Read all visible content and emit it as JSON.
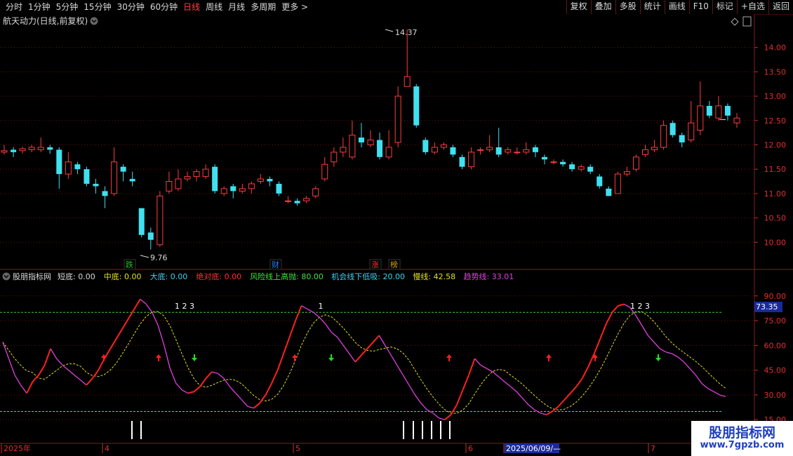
{
  "toolbar": {
    "tabs": [
      "分时",
      "1分钟",
      "5分钟",
      "15分钟",
      "30分钟",
      "60分钟",
      "日线",
      "周线",
      "月线",
      "多周期",
      "更多 >"
    ],
    "active_tab": "日线",
    "right_buttons": [
      "复权",
      "叠加",
      "多股",
      "统计",
      "画线",
      "F10",
      "标记",
      "+自选",
      "返回"
    ]
  },
  "main_chart": {
    "title": "航天动力(日线,前复权)",
    "price_axis": [
      "14.00",
      "13.50",
      "13.00",
      "12.50",
      "12.00",
      "11.50",
      "11.00",
      "10.50",
      "10.00"
    ],
    "high_label": "14.37",
    "low_label": "9.76",
    "badges": [
      {
        "text": "跌",
        "color": "#20c020"
      },
      {
        "text": "财",
        "color": "#2080ff"
      },
      {
        "text": "涨",
        "color": "#ff3030"
      },
      {
        "text": "榜",
        "color": "#d0a000"
      }
    ]
  },
  "indicator": {
    "name": "股朋指标网",
    "params": [
      {
        "label": "短底:",
        "value": "0.00",
        "color": "#d8d8d8"
      },
      {
        "label": "中底:",
        "value": "0.00",
        "color": "#e0e020"
      },
      {
        "label": "大底:",
        "value": "0.00",
        "color": "#40d0f0"
      },
      {
        "label": "绝对底:",
        "value": "0.00",
        "color": "#ff3030"
      },
      {
        "label": "风险线上高抛:",
        "value": "80.00",
        "color": "#40e040"
      },
      {
        "label": "机会线下低吸:",
        "value": "20.00",
        "color": "#40d0f0"
      },
      {
        "label": "慢线:",
        "value": "42.58",
        "color": "#e0e020"
      },
      {
        "label": "趋势线:",
        "value": "33.01",
        "color": "#e040e0"
      }
    ],
    "axis": [
      "90.00",
      "75.00",
      "60.00",
      "45.00",
      "30.00",
      "15.00"
    ],
    "current_value": "73.35",
    "signal_labels": [
      "1 2 3",
      "1",
      "1 2 3"
    ]
  },
  "time_axis": {
    "labels": [
      "2025年",
      "4",
      "5",
      "6",
      "2025/06/09/—",
      "7"
    ]
  },
  "watermark": {
    "line1": "股朋指标网",
    "line2": "www.7gpzb.com"
  },
  "chart_data": {
    "type": "candlestick",
    "y_range": [
      9.5,
      14.6
    ],
    "candles": [
      [
        11.85,
        11.88,
        12.0,
        11.8
      ],
      [
        11.9,
        11.85,
        11.95,
        11.75
      ],
      [
        11.88,
        11.92,
        11.96,
        11.82
      ],
      [
        11.9,
        11.95,
        12.0,
        11.85
      ],
      [
        11.9,
        11.95,
        12.15,
        11.85
      ],
      [
        11.95,
        11.9,
        12.0,
        11.82
      ],
      [
        11.9,
        11.4,
        11.95,
        11.1
      ],
      [
        11.4,
        11.65,
        11.85,
        11.3
      ],
      [
        11.6,
        11.5,
        11.65,
        11.4
      ],
      [
        11.5,
        11.2,
        11.55,
        11.15
      ],
      [
        11.2,
        11.15,
        11.3,
        11.0
      ],
      [
        11.05,
        10.95,
        11.15,
        10.7
      ],
      [
        11.0,
        11.65,
        11.95,
        10.95
      ],
      [
        11.55,
        11.45,
        11.6,
        11.25
      ],
      [
        11.3,
        11.25,
        11.45,
        11.15
      ],
      [
        10.7,
        10.15,
        10.7,
        10.1
      ],
      [
        10.2,
        10.05,
        10.3,
        9.85
      ],
      [
        9.95,
        10.95,
        11.05,
        9.9
      ],
      [
        11.05,
        11.25,
        11.45,
        11.0
      ],
      [
        11.1,
        11.3,
        11.5,
        11.05
      ],
      [
        11.3,
        11.35,
        11.45,
        11.25
      ],
      [
        11.35,
        11.45,
        11.5,
        11.25
      ],
      [
        11.35,
        11.5,
        11.6,
        11.3
      ],
      [
        11.55,
        11.05,
        11.6,
        11.0
      ],
      [
        11.0,
        11.1,
        11.15,
        10.95
      ],
      [
        11.15,
        11.05,
        11.2,
        10.9
      ],
      [
        11.05,
        11.1,
        11.2,
        11.0
      ],
      [
        11.1,
        11.2,
        11.25,
        11.0
      ],
      [
        11.25,
        11.3,
        11.4,
        11.2
      ],
      [
        11.3,
        11.25,
        11.35,
        11.15
      ],
      [
        11.2,
        11.0,
        11.25,
        10.95
      ],
      [
        10.85,
        10.85,
        10.95,
        10.8
      ],
      [
        10.85,
        10.8,
        10.9,
        10.75
      ],
      [
        10.85,
        10.9,
        10.95,
        10.8
      ],
      [
        10.95,
        11.1,
        11.15,
        10.9
      ],
      [
        11.3,
        11.6,
        11.75,
        11.25
      ],
      [
        11.65,
        11.85,
        11.95,
        11.55
      ],
      [
        11.85,
        11.95,
        12.15,
        11.75
      ],
      [
        11.75,
        12.2,
        12.5,
        11.7
      ],
      [
        12.15,
        12.05,
        12.45,
        11.95
      ],
      [
        12.0,
        12.1,
        12.3,
        11.95
      ],
      [
        12.1,
        11.75,
        12.25,
        11.7
      ],
      [
        11.75,
        11.95,
        12.3,
        11.7
      ],
      [
        12.05,
        13.0,
        13.2,
        11.95
      ],
      [
        13.2,
        13.4,
        14.37,
        13.2
      ],
      [
        13.2,
        12.4,
        13.25,
        12.35
      ],
      [
        12.1,
        11.85,
        12.15,
        11.8
      ],
      [
        11.85,
        11.95,
        12.05,
        11.8
      ],
      [
        11.95,
        12.0,
        12.05,
        11.9
      ],
      [
        11.95,
        11.8,
        12.0,
        11.75
      ],
      [
        11.75,
        11.55,
        11.8,
        11.5
      ],
      [
        11.55,
        11.85,
        11.95,
        11.5
      ],
      [
        11.9,
        11.9,
        11.95,
        11.8
      ],
      [
        11.9,
        11.95,
        12.2,
        11.85
      ],
      [
        11.95,
        11.8,
        12.35,
        11.75
      ],
      [
        11.85,
        11.9,
        11.95,
        11.8
      ],
      [
        11.85,
        11.85,
        11.95,
        11.8
      ],
      [
        11.85,
        11.9,
        12.05,
        11.8
      ],
      [
        11.95,
        11.85,
        12.0,
        11.75
      ],
      [
        11.75,
        11.7,
        11.8,
        11.6
      ],
      [
        11.65,
        11.65,
        11.7,
        11.6
      ],
      [
        11.65,
        11.6,
        11.7,
        11.55
      ],
      [
        11.6,
        11.5,
        11.65,
        11.45
      ],
      [
        11.5,
        11.55,
        11.6,
        11.45
      ],
      [
        11.55,
        11.45,
        11.6,
        11.4
      ],
      [
        11.35,
        11.15,
        11.4,
        11.1
      ],
      [
        11.1,
        10.95,
        11.15,
        10.95
      ],
      [
        11.0,
        11.4,
        11.45,
        11.0
      ],
      [
        11.4,
        11.45,
        11.55,
        11.35
      ],
      [
        11.5,
        11.75,
        11.8,
        11.45
      ],
      [
        11.8,
        11.9,
        12.0,
        11.75
      ],
      [
        11.9,
        11.95,
        12.1,
        11.85
      ],
      [
        11.95,
        12.4,
        12.5,
        11.9
      ],
      [
        12.45,
        12.2,
        12.5,
        12.15
      ],
      [
        12.2,
        12.05,
        12.25,
        11.95
      ],
      [
        12.1,
        12.45,
        12.9,
        12.05
      ],
      [
        12.3,
        12.8,
        13.3,
        12.2
      ],
      [
        12.8,
        12.6,
        12.9,
        12.55
      ],
      [
        12.55,
        12.8,
        13.0,
        12.5
      ],
      [
        12.8,
        12.6,
        12.85,
        12.5
      ],
      [
        12.45,
        12.55,
        12.65,
        12.35
      ]
    ],
    "last_price": 12.52,
    "indicator_y_range": [
      10,
      95
    ],
    "reference_lines": [
      80,
      20
    ],
    "fast_line": [
      62,
      52,
      42,
      36,
      31,
      38,
      42,
      48,
      58,
      52,
      48,
      45,
      42,
      39,
      36,
      40,
      45,
      52,
      58,
      64,
      70,
      76,
      82,
      88,
      85,
      80,
      72,
      60,
      46,
      37,
      33,
      31,
      32,
      35,
      40,
      44,
      43,
      40,
      35,
      31,
      27,
      23,
      22,
      25,
      30,
      37,
      45,
      55,
      65,
      75,
      84,
      82,
      80,
      77,
      73,
      68,
      65,
      60,
      55,
      50,
      54,
      58,
      62,
      66,
      60,
      54,
      48,
      42,
      36,
      30,
      25,
      21,
      19,
      16,
      15,
      18,
      24,
      33,
      42,
      52,
      48,
      46,
      44,
      41,
      38,
      35,
      32,
      28,
      24,
      21,
      19,
      18,
      20,
      23,
      27,
      31,
      35,
      40,
      47,
      55,
      64,
      73,
      80,
      84,
      85,
      83,
      78,
      72,
      66,
      62,
      58,
      56,
      55,
      53,
      50,
      46,
      42,
      37,
      34,
      32,
      30,
      29
    ]
  }
}
